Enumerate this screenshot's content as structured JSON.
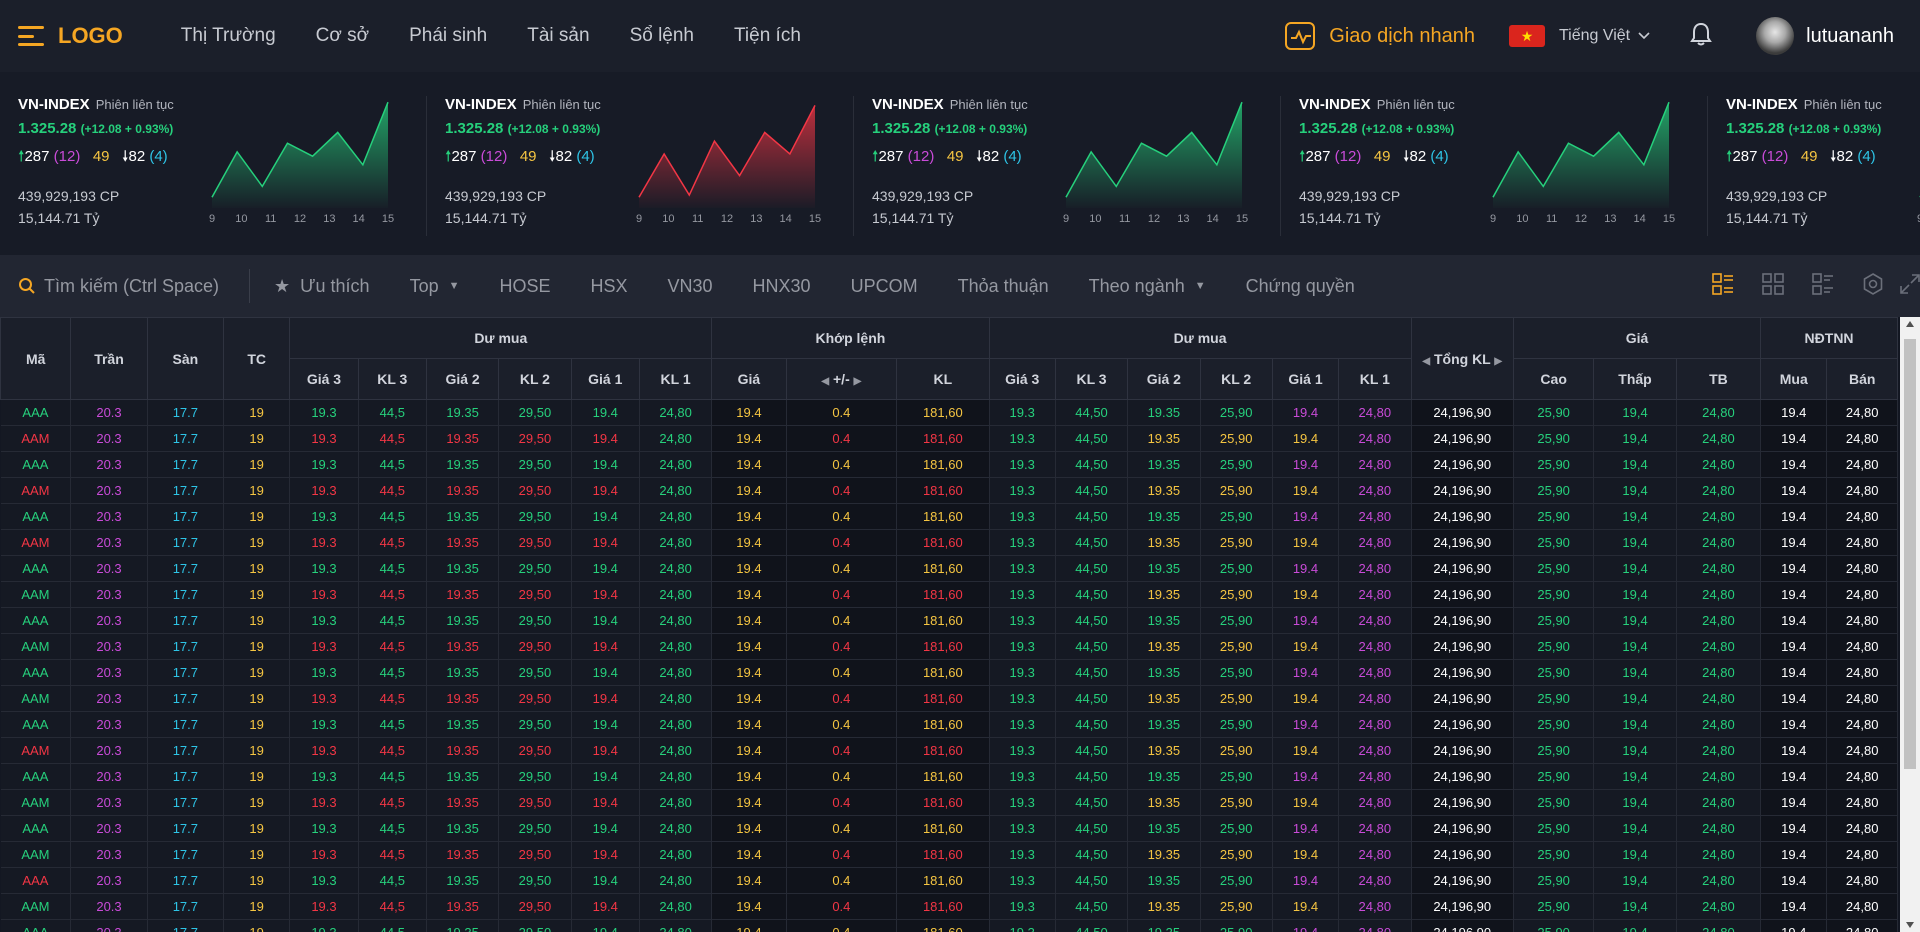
{
  "header": {
    "logo": "LOGO",
    "nav": [
      "Thị Trường",
      "Cơ sở",
      "Phái sinh",
      "Tài sản",
      "Sổ lệnh",
      "Tiện ích"
    ],
    "quick_trade": "Giao dịch nhanh",
    "language": "Tiếng Việt",
    "username": "lutuananh",
    "icons": [
      "menu-icon",
      "pulse-icon",
      "vietnam-flag-icon",
      "chevron-down-icon",
      "bell-icon",
      "avatar"
    ]
  },
  "indices": [
    {
      "name": "VN-INDEX",
      "session": "Phiên liên tục",
      "value": "1.325.28",
      "change": "(+12.08 + 0.93%)",
      "up": "287",
      "up_ceiling": "(12)",
      "ref": "49",
      "down": "82",
      "down_floor": "(4)",
      "volume": "439,929,193 CP",
      "turnover": "15,144.71 Tỷ",
      "trend": "up",
      "chart_x": [
        "9",
        "10",
        "11",
        "12",
        "13",
        "14",
        "15"
      ],
      "chart_values": [
        10,
        52,
        20,
        60,
        48,
        70,
        40,
        98
      ]
    },
    {
      "name": "VN-INDEX",
      "session": "Phiên liên tục",
      "value": "1.325.28",
      "change": "(+12.08 + 0.93%)",
      "up": "287",
      "up_ceiling": "(12)",
      "ref": "49",
      "down": "82",
      "down_floor": "(4)",
      "volume": "439,929,193 CP",
      "turnover": "15,144.71 Tỷ",
      "trend": "down",
      "chart_x": [
        "9",
        "10",
        "11",
        "12",
        "13",
        "14",
        "15"
      ],
      "chart_values": [
        10,
        50,
        12,
        62,
        30,
        70,
        50,
        95
      ]
    },
    {
      "name": "VN-INDEX",
      "session": "Phiên liên tục",
      "value": "1.325.28",
      "change": "(+12.08 + 0.93%)",
      "up": "287",
      "up_ceiling": "(12)",
      "ref": "49",
      "down": "82",
      "down_floor": "(4)",
      "volume": "439,929,193 CP",
      "turnover": "15,144.71 Tỷ",
      "trend": "up",
      "chart_x": [
        "9",
        "10",
        "11",
        "12",
        "13",
        "14",
        "15"
      ],
      "chart_values": [
        10,
        52,
        20,
        60,
        48,
        70,
        40,
        98
      ]
    },
    {
      "name": "VN-INDEX",
      "session": "Phiên liên tục",
      "value": "1.325.28",
      "change": "(+12.08 + 0.93%)",
      "up": "287",
      "up_ceiling": "(12)",
      "ref": "49",
      "down": "82",
      "down_floor": "(4)",
      "volume": "439,929,193 CP",
      "turnover": "15,144.71 Tỷ",
      "trend": "up",
      "chart_x": [
        "9",
        "10",
        "11",
        "12",
        "13",
        "14",
        "15"
      ],
      "chart_values": [
        10,
        52,
        20,
        60,
        48,
        70,
        40,
        98
      ]
    },
    {
      "name": "VN-INDEX",
      "session": "Phiên liên tục",
      "value": "1.325.28",
      "change": "(+12.08 + 0.93%)",
      "up": "287",
      "up_ceiling": "(12)",
      "ref": "49",
      "down": "82",
      "down_floor": "(4)",
      "volume": "439,929,193 CP",
      "turnover": "15,144.71 Tỷ",
      "trend": "up",
      "chart_x": [
        "9",
        "10",
        "11",
        "12",
        "13",
        "14",
        "15"
      ],
      "chart_values": [
        10,
        52,
        20,
        60,
        48,
        70,
        40,
        98
      ]
    }
  ],
  "toolbar": {
    "search_placeholder": "Tìm kiếm (Ctrl Space)",
    "favorite": "Ưu thích",
    "top": "Top",
    "tabs": [
      "HOSE",
      "HSX",
      "VN30",
      "HNX30",
      "UPCOM",
      "Thỏa thuận"
    ],
    "industry": "Theo ngành",
    "warrant": "Chứng quyền",
    "view_icons": [
      "layout-list-icon",
      "grid-icon",
      "layout-detail-icon",
      "settings-icon",
      "expand-icon"
    ]
  },
  "table": {
    "group_headers": {
      "ma": "Mã",
      "tran": "Trần",
      "san": "Sàn",
      "tc": "TC",
      "du_mua_left": "Dư mua",
      "khop_lenh": "Khớp lệnh",
      "du_mua_right": "Dư mua",
      "tong_kl": "Tổng KL",
      "gia": "Giá",
      "ndtnn": "NĐTNN"
    },
    "sub_headers": [
      "Giá 3",
      "KL 3",
      "Giá 2",
      "KL 2",
      "Giá 1",
      "KL 1",
      "Giá",
      "+/-",
      "KL",
      "Giá 3",
      "KL 3",
      "Giá 2",
      "KL 2",
      "Giá 1",
      "KL 1",
      "Cao",
      "Thấp",
      "TB",
      "Mua",
      "Bán"
    ],
    "row_a": [
      "20.3",
      "17.7",
      "19",
      "19.3",
      "44,5",
      "19.35",
      "29,50",
      "19.4",
      "24,80",
      "19.4",
      "0.4",
      "181,60",
      "19.3",
      "44,50",
      "19.35",
      "25,90",
      "19.4",
      "24,80",
      "24,196,90",
      "25,90",
      "19,4",
      "24,80",
      "19.4",
      "24,80"
    ],
    "rows": [
      {
        "code": "AAA",
        "dir": "up",
        "rt": "p"
      },
      {
        "code": "AAM",
        "dir": "down",
        "rt": "y"
      },
      {
        "code": "AAA",
        "dir": "up",
        "rt": "p"
      },
      {
        "code": "AAM",
        "dir": "down",
        "rt": "y"
      },
      {
        "code": "AAA",
        "dir": "up",
        "rt": "p"
      },
      {
        "code": "AAM",
        "dir": "down",
        "rt": "y"
      },
      {
        "code": "AAA",
        "dir": "up",
        "rt": "p"
      },
      {
        "code": "AAM",
        "dir": "down",
        "rt": "y",
        "codecolor": "g"
      },
      {
        "code": "AAA",
        "dir": "up",
        "rt": "p"
      },
      {
        "code": "AAM",
        "dir": "down",
        "rt": "y",
        "codecolor": "g"
      },
      {
        "code": "AAA",
        "dir": "up",
        "rt": "p"
      },
      {
        "code": "AAM",
        "dir": "down",
        "rt": "y",
        "codecolor": "g"
      },
      {
        "code": "AAA",
        "dir": "up",
        "rt": "p"
      },
      {
        "code": "AAM",
        "dir": "down",
        "rt": "y"
      },
      {
        "code": "AAA",
        "dir": "up",
        "rt": "p"
      },
      {
        "code": "AAM",
        "dir": "down",
        "rt": "y",
        "codecolor": "g"
      },
      {
        "code": "AAA",
        "dir": "up",
        "rt": "p"
      },
      {
        "code": "AAM",
        "dir": "down",
        "rt": "y",
        "codecolor": "g"
      },
      {
        "code": "AAA",
        "dir": "up",
        "rt": "p",
        "codecolor": "r"
      },
      {
        "code": "AAM",
        "dir": "down",
        "rt": "y",
        "codecolor": "g"
      },
      {
        "code": "AAA",
        "dir": "up",
        "rt": "p"
      }
    ]
  },
  "colors": {
    "accent": "#f5a623",
    "up": "#26d07c",
    "down": "#f23645",
    "ceiling": "#c94bd8",
    "floor": "#2ec4e6",
    "ref": "#f5c542"
  }
}
